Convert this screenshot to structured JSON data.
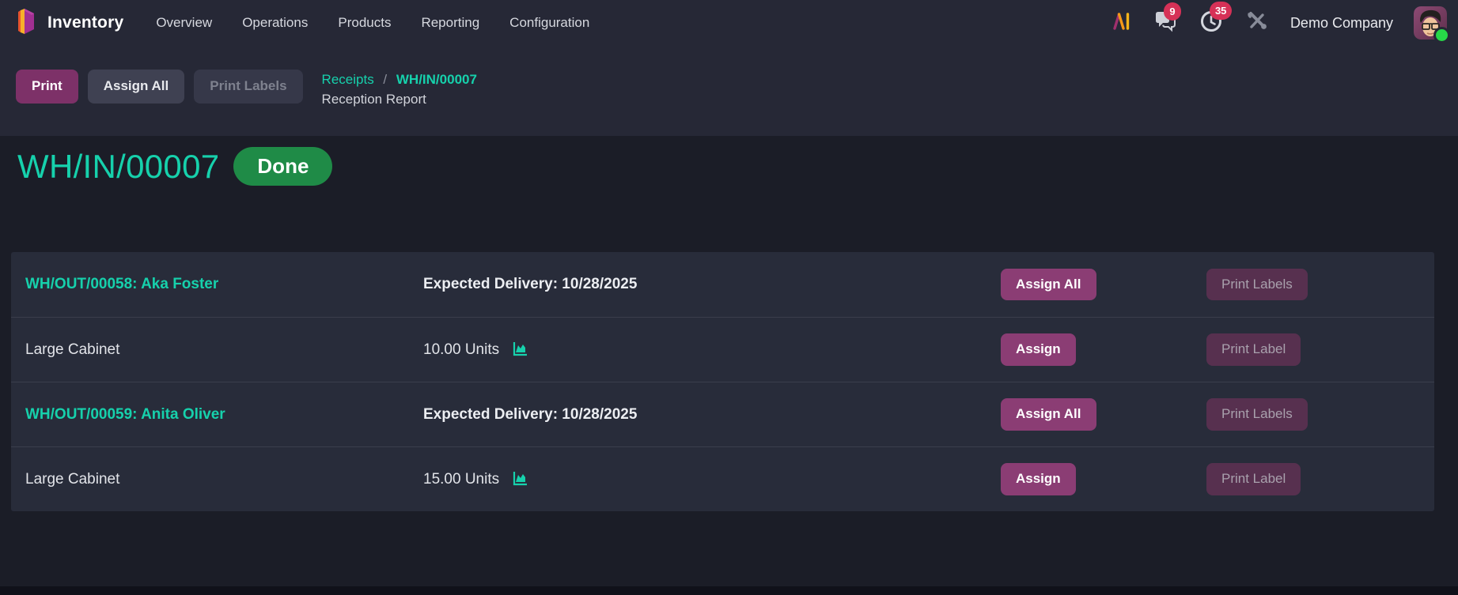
{
  "navbar": {
    "brand": "Inventory",
    "menu": [
      {
        "label": "Overview"
      },
      {
        "label": "Operations"
      },
      {
        "label": "Products"
      },
      {
        "label": "Reporting"
      },
      {
        "label": "Configuration"
      }
    ],
    "messages_badge": "9",
    "activities_badge": "35",
    "company": "Demo Company"
  },
  "toolbar": {
    "print_label": "Print",
    "assign_all_label": "Assign All",
    "print_labels_label": "Print Labels",
    "breadcrumb": {
      "parent": "Receipts",
      "separator": "/",
      "current": "WH/IN/00007"
    },
    "subtitle": "Reception Report"
  },
  "page": {
    "title": "WH/IN/00007",
    "status": "Done"
  },
  "table": {
    "groups": [
      {
        "reference": "WH/OUT/00058",
        "sep": ": ",
        "partner": "Aka Foster",
        "delivery": "Expected Delivery: 10/28/2025",
        "assign_all": "Assign All",
        "print_labels": "Print Labels",
        "line": {
          "product": "Large Cabinet",
          "qty": "10.00 Units",
          "assign": "Assign",
          "print_label": "Print Label"
        }
      },
      {
        "reference": "WH/OUT/00059",
        "sep": ": ",
        "partner": "Anita Oliver",
        "delivery": "Expected Delivery: 10/28/2025",
        "assign_all": "Assign All",
        "print_labels": "Print Labels",
        "line": {
          "product": "Large Cabinet",
          "qty": "15.00 Units",
          "assign": "Assign",
          "print_label": "Print Label"
        }
      }
    ]
  },
  "colors": {
    "accent_teal": "#16d1ac",
    "primary_purple": "#8b3d74",
    "toolbar_purple": "#7d3168",
    "done_green": "#1f8b47",
    "badge_red": "#d63157",
    "header_bg": "#262836",
    "content_bg": "#1b1d27",
    "table_bg": "#282c3a"
  }
}
